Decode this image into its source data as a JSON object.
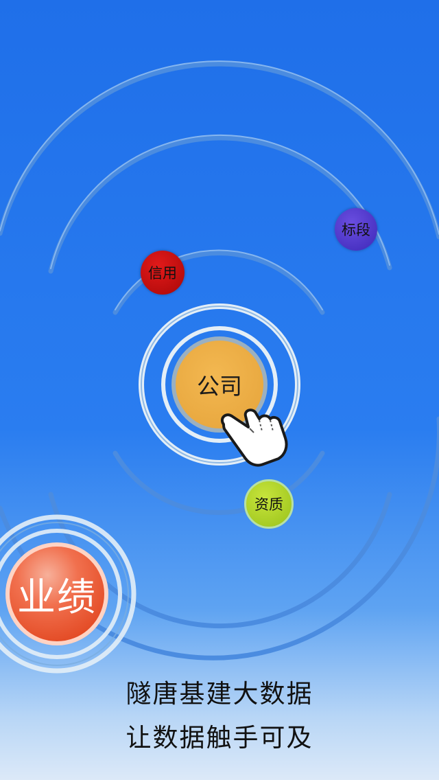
{
  "bubbles": {
    "credit": "信用",
    "section": "标段",
    "company": "公司",
    "qualification": "资质",
    "performance": "业绩"
  },
  "tagline": {
    "line1": "隧唐基建大数据",
    "line2": "让数据触手可及"
  },
  "colors": {
    "background_top": "#1f6fe9",
    "background_bottom": "#dce9f8",
    "credit": "#c80d0d",
    "section": "#5238c8",
    "company": "#e9a843",
    "qualification": "#b2d52e",
    "performance": "#ec5a33"
  },
  "icons": [
    "tap-hand-icon"
  ]
}
